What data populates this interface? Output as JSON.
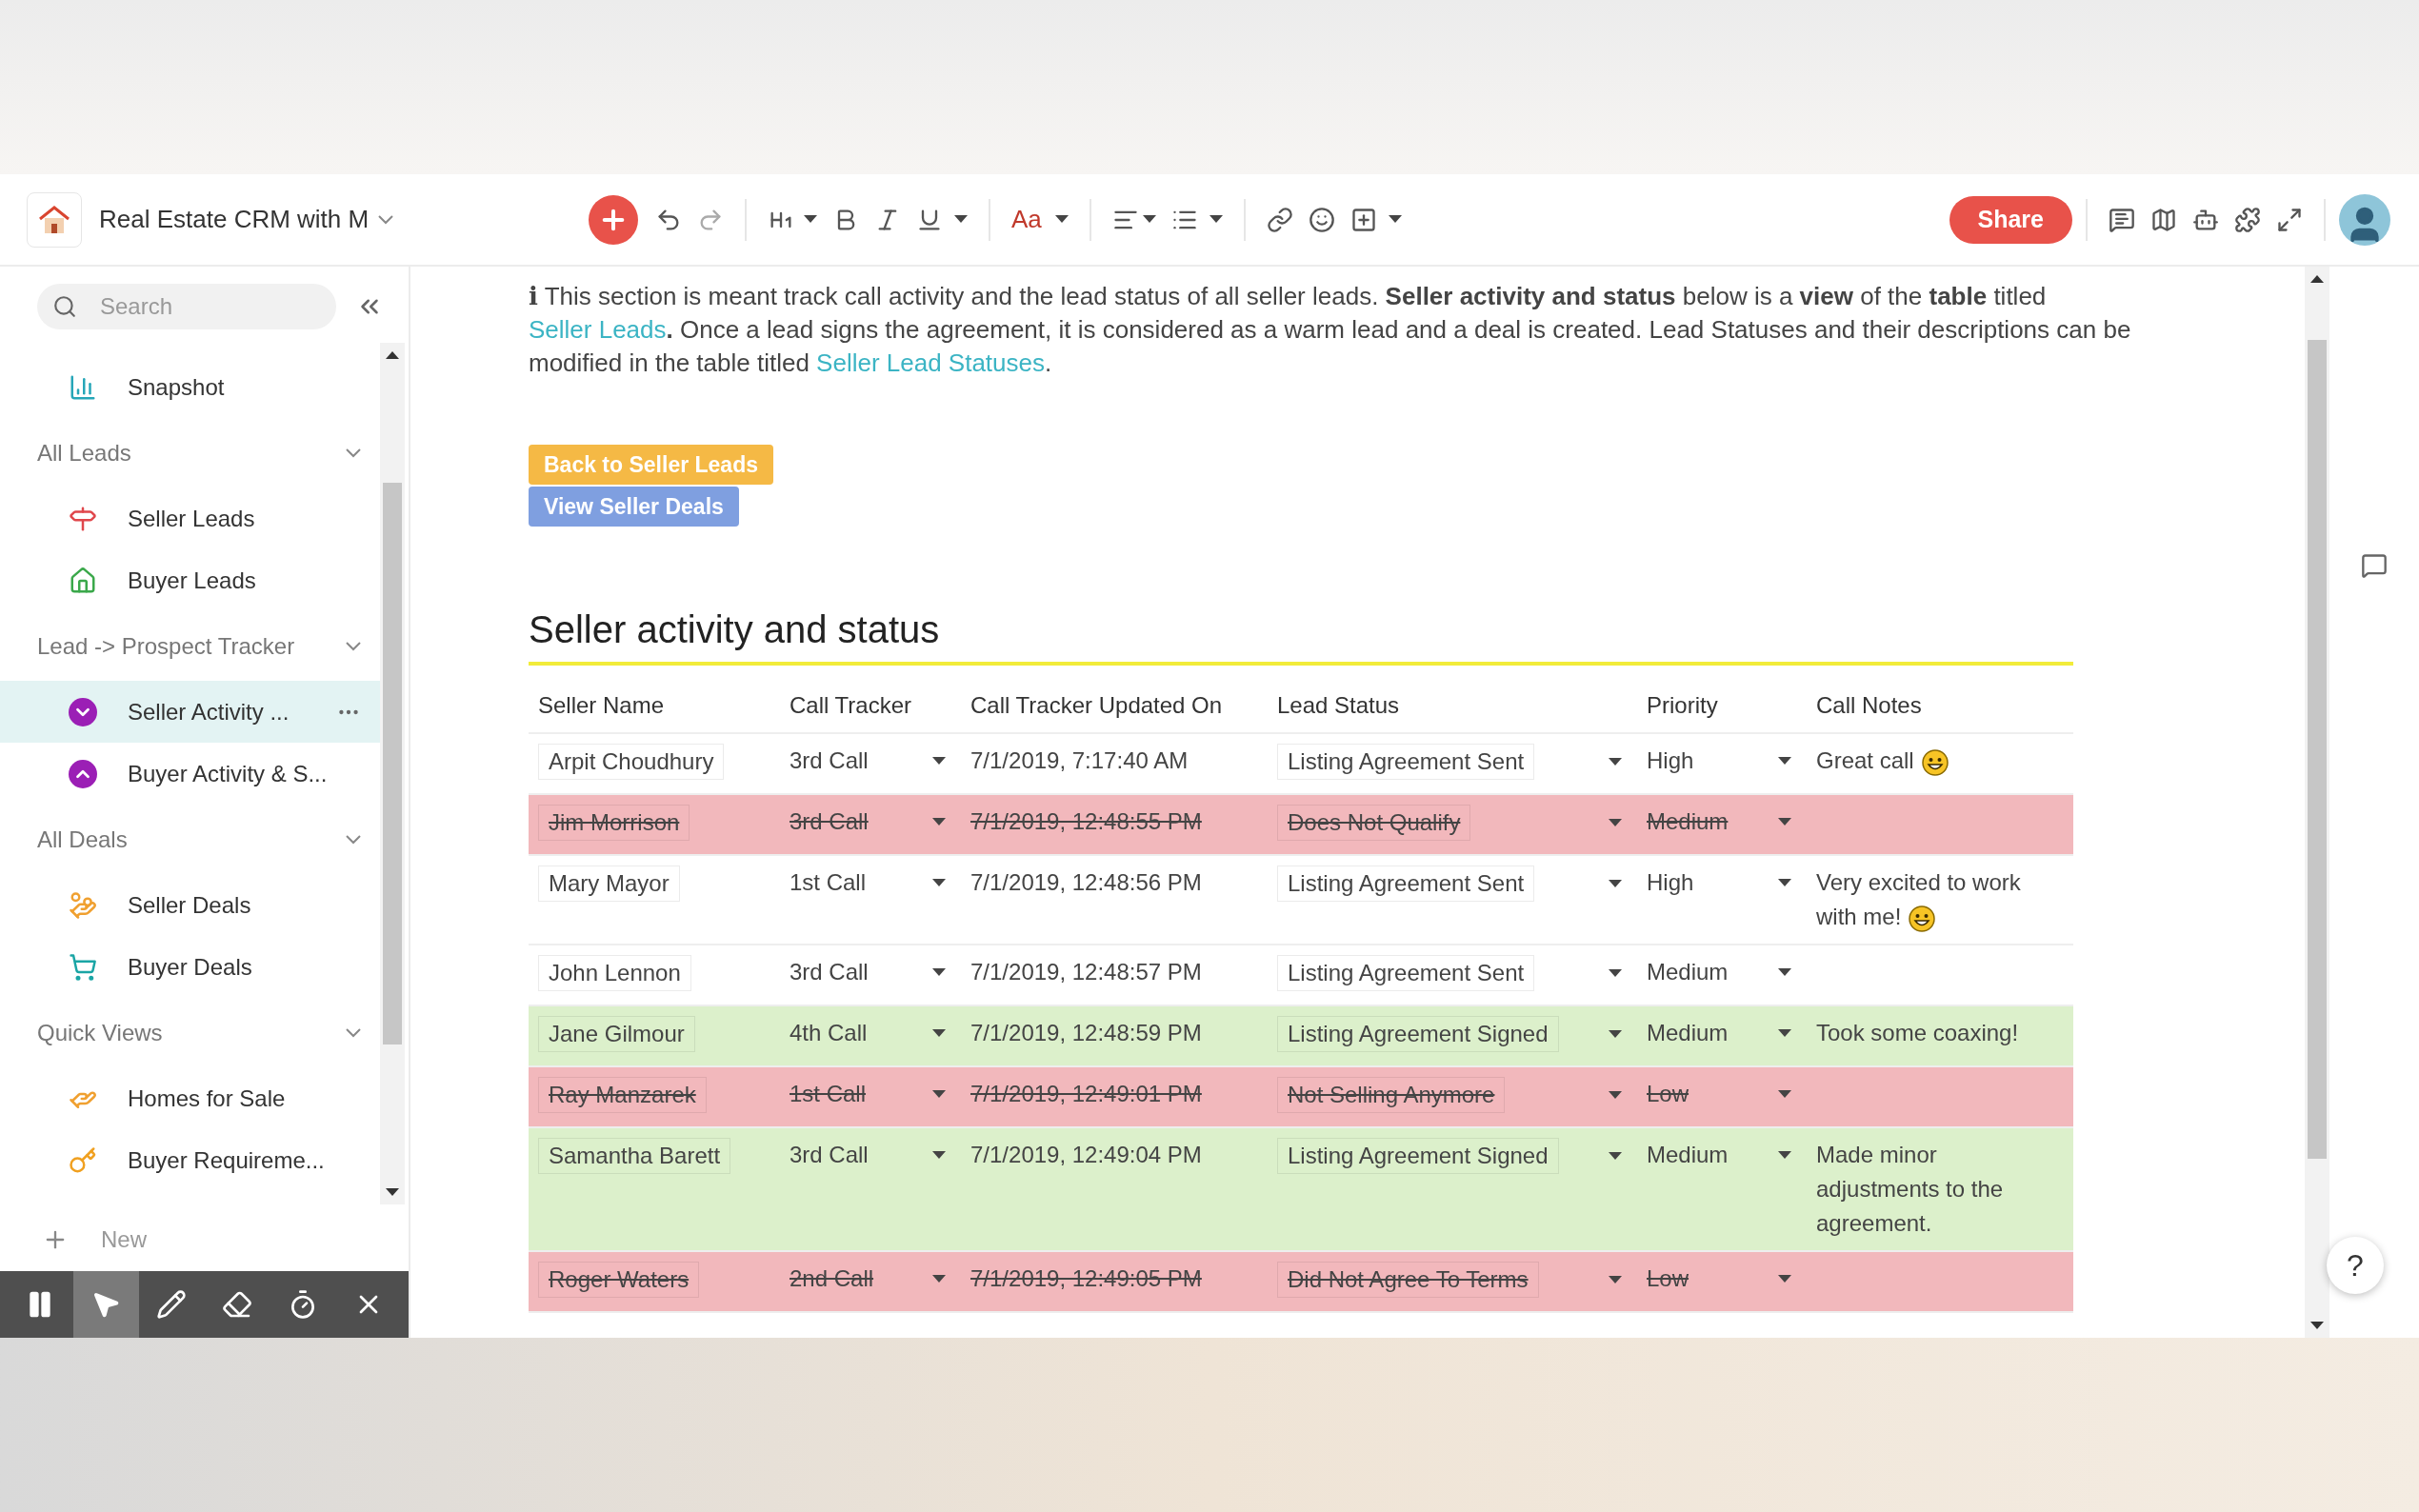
{
  "toolbar": {
    "doc_title": "Real Estate CRM with M",
    "font_button": "Aa",
    "share": "Share"
  },
  "sidebar": {
    "search": {
      "placeholder": "Search"
    },
    "top_items": [
      {
        "label": "Snapshot",
        "selected": false
      }
    ],
    "sections": [
      {
        "title": "All Leads",
        "expanded": true,
        "items": [
          {
            "label": "Seller Leads",
            "selected": false
          },
          {
            "label": "Buyer Leads",
            "selected": false
          }
        ]
      },
      {
        "title": "Lead -> Prospect Tracker",
        "expanded": true,
        "items": [
          {
            "label": "Seller Activity ...",
            "selected": true
          },
          {
            "label": "Buyer Activity & S...",
            "selected": false
          }
        ]
      },
      {
        "title": "All Deals",
        "expanded": true,
        "items": [
          {
            "label": "Seller Deals",
            "selected": false
          },
          {
            "label": "Buyer Deals",
            "selected": false
          }
        ]
      },
      {
        "title": "Quick Views",
        "expanded": true,
        "items": [
          {
            "label": "Homes for Sale",
            "selected": false
          },
          {
            "label": "Buyer Requireme...",
            "selected": false
          }
        ]
      }
    ],
    "new_label": "New"
  },
  "recorder": {
    "tools": [
      {
        "selected": false
      },
      {
        "selected": true
      },
      {
        "selected": false
      },
      {
        "selected": false
      },
      {
        "selected": false
      },
      {
        "selected": false
      }
    ]
  },
  "intro": {
    "info_mark": "i",
    "segments": [
      {
        "kind": "text",
        "text": " This section is meant track call activity and the lead status of all seller leads. **Seller activity and status** below is a **view** of the **table** titled "
      },
      {
        "kind": "link",
        "text": "Seller Leads"
      },
      {
        "kind": "text",
        "text": "**.** Once a lead signs the agreement, it is considered as a warm lead and a deal is created. Lead Statuses and their descriptions can be modified in the table titled "
      },
      {
        "kind": "link",
        "text": "Seller Lead Statuses"
      },
      {
        "kind": "text",
        "text": "."
      }
    ]
  },
  "buttons": [
    {
      "label": "Back to Seller Leads",
      "color": "#f5b945"
    },
    {
      "label": "View Seller Deals",
      "color": "#7f9fe0"
    }
  ],
  "section_title": "Seller activity and status",
  "table": {
    "columns": [
      "Seller Name",
      "Call Tracker",
      "Call Tracker Updated On",
      "Lead Status",
      "Priority",
      "Call Notes"
    ],
    "rows": [
      {
        "kind": "open",
        "name": "Arpit Choudhury",
        "call": "3rd Call",
        "updated": "7/1/2019, 7:17:40 AM",
        "lead_status": "Listing Agreement Sent",
        "priority": "High",
        "notes": "Great call",
        "emoji": true
      },
      {
        "kind": "struck",
        "name": "Jim Morrison",
        "call": "3rd Call",
        "updated": "7/1/2019, 12:48:55 PM",
        "lead_status": "Does Not Qualify",
        "priority": "Medium"
      },
      {
        "kind": "open",
        "name": "Mary Mayor",
        "call": "1st Call",
        "updated": "7/1/2019, 12:48:56 PM",
        "lead_status": "Listing Agreement Sent",
        "priority": "High",
        "notes": "Very excited to work with me!",
        "emoji": true
      },
      {
        "kind": "open",
        "name": "John  Lennon",
        "call": "3rd Call",
        "updated": "7/1/2019, 12:48:57 PM",
        "lead_status": "Listing Agreement Sent",
        "priority": "Medium"
      },
      {
        "kind": "signed",
        "name": "Jane Gilmour",
        "call": "4th Call",
        "updated": "7/1/2019, 12:48:59 PM",
        "lead_status": "Listing Agreement Signed",
        "priority": "Medium",
        "notes": "Took some coaxing!",
        "emoji": false
      },
      {
        "kind": "struck",
        "name": "Ray Manzarek",
        "call": "1st Call",
        "updated": "7/1/2019, 12:49:01 PM",
        "lead_status": "Not Selling Anymore",
        "priority": "Low"
      },
      {
        "kind": "signed",
        "name": "Samantha Barett",
        "call": "3rd Call",
        "updated": "7/1/2019, 12:49:04 PM",
        "lead_status": "Listing Agreement Signed",
        "priority": "Medium",
        "notes": "Made minor adjustments to the agreement.",
        "emoji": false
      },
      {
        "kind": "struck",
        "name": "Roger Waters",
        "call": "2nd Call",
        "updated": "7/1/2019, 12:49:05 PM",
        "lead_status": "Did Not Agree To Terms",
        "priority": "Low"
      }
    ]
  },
  "help": "?"
}
